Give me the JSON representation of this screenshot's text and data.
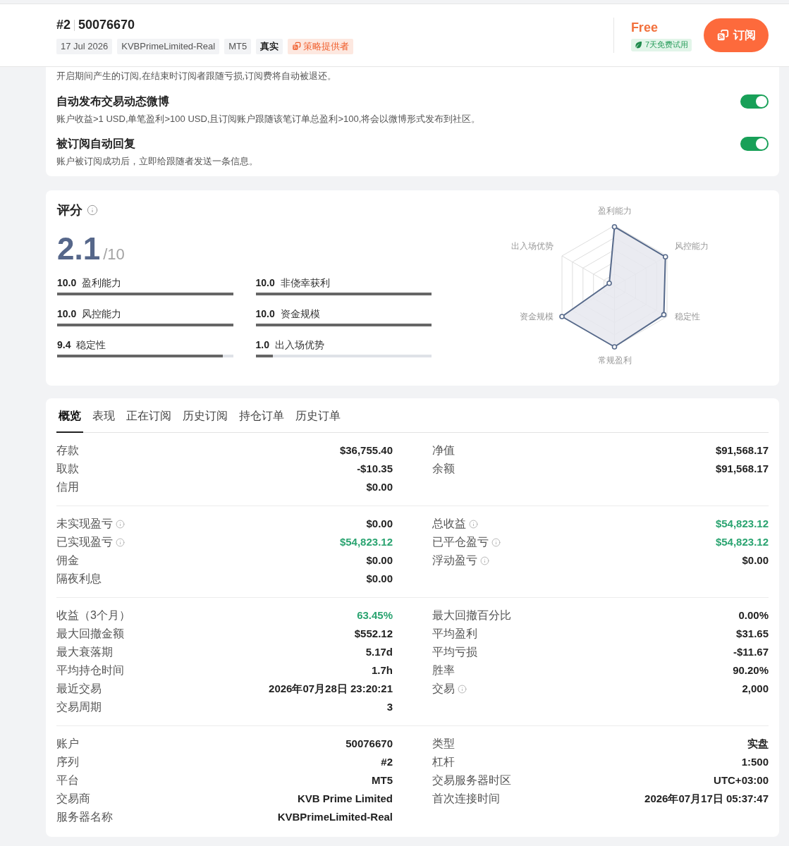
{
  "header": {
    "rank": "#2",
    "account": "50076670",
    "tags": [
      {
        "text": "17 Jul 2026",
        "kind": "plain"
      },
      {
        "text": "KVBPrimeLimited-Real",
        "kind": "plain"
      },
      {
        "text": "MT5",
        "kind": "plain"
      },
      {
        "text": "真实",
        "kind": "strong"
      },
      {
        "text": "策略提供者",
        "kind": "provider"
      }
    ],
    "price": "Free",
    "trial_badge": "7天免费试用",
    "subscribe_button": "订阅"
  },
  "settings": {
    "intro": "开启期间产生的订阅,在结束时订阅者跟随亏损,订阅费将自动被退还。",
    "items": [
      {
        "title": "自动发布交易动态微博",
        "description": "账户收益>1 USD,单笔盈利>100 USD,且订阅账户跟随该笔订单总盈利>100,将会以微博形式发布到社区。",
        "on": true
      },
      {
        "title": "被订阅自动回复",
        "description": "账户被订阅成功后，立即给跟随者发送一条信息。",
        "on": true
      }
    ]
  },
  "score": {
    "title": "评分",
    "value": "2.1",
    "max": "/10",
    "metrics": [
      {
        "score": "10.0",
        "label": "盈利能力",
        "level": 1
      },
      {
        "score": "10.0",
        "label": "非侥幸获利",
        "level": 1
      },
      {
        "score": "10.0",
        "label": "风控能力",
        "level": 1
      },
      {
        "score": "10.0",
        "label": "资金规模",
        "level": 1
      },
      {
        "score": "9.4",
        "label": "稳定性",
        "level": 0.94
      },
      {
        "score": "1.0",
        "label": "出入场优势",
        "level": 0.1
      }
    ],
    "radar_axes": [
      "盈利能力",
      "风控能力",
      "稳定性",
      "常规盈利",
      "资金规模",
      "出入场优势"
    ]
  },
  "tabs": [
    {
      "label": "概览",
      "selected": true
    },
    {
      "label": "表现",
      "selected": false
    },
    {
      "label": "正在订阅",
      "selected": false
    },
    {
      "label": "历史订阅",
      "selected": false
    },
    {
      "label": "持仓订单",
      "selected": false
    },
    {
      "label": "历史订单",
      "selected": false
    }
  ],
  "stats": [
    {
      "left": [
        {
          "label": "存款",
          "value": "$36,755.40",
          "info": false,
          "positive": false
        },
        {
          "label": "取款",
          "value": "-$10.35",
          "info": false,
          "positive": false
        },
        {
          "label": "信用",
          "value": "$0.00",
          "info": false,
          "positive": false
        }
      ],
      "right": [
        {
          "label": "净值",
          "value": "$91,568.17",
          "info": false,
          "positive": false
        },
        {
          "label": "余额",
          "value": "$91,568.17",
          "info": false,
          "positive": false
        }
      ]
    },
    {
      "left": [
        {
          "label": "未实现盈亏",
          "value": "$0.00",
          "info": true,
          "positive": false
        },
        {
          "label": "已实现盈亏",
          "value": "$54,823.12",
          "info": true,
          "positive": true
        },
        {
          "label": "佣金",
          "value": "$0.00",
          "info": false,
          "positive": false
        },
        {
          "label": "隔夜利息",
          "value": "$0.00",
          "info": false,
          "positive": false
        }
      ],
      "right": [
        {
          "label": "总收益",
          "value": "$54,823.12",
          "info": true,
          "positive": true
        },
        {
          "label": "已平仓盈亏",
          "value": "$54,823.12",
          "info": true,
          "positive": true
        },
        {
          "label": "浮动盈亏",
          "value": "$0.00",
          "info": true,
          "positive": false
        }
      ]
    },
    {
      "left": [
        {
          "label": "收益（3个月）",
          "value": "63.45%",
          "info": false,
          "positive": true
        },
        {
          "label": "最大回撤金额",
          "value": "$552.12",
          "info": false,
          "positive": false
        },
        {
          "label": "最大衰落期",
          "value": "5.17d",
          "info": false,
          "positive": false
        },
        {
          "label": "平均持仓时间",
          "value": "1.7h",
          "info": false,
          "positive": false
        },
        {
          "label": "最近交易",
          "value": "2026年07月28日 23:20:21",
          "info": false,
          "positive": false
        },
        {
          "label": "交易周期",
          "value": "3",
          "info": false,
          "positive": false
        }
      ],
      "right": [
        {
          "label": "最大回撤百分比",
          "value": "0.00%",
          "info": false,
          "positive": false
        },
        {
          "label": "平均盈利",
          "value": "$31.65",
          "info": false,
          "positive": false
        },
        {
          "label": "平均亏损",
          "value": "-$11.67",
          "info": false,
          "positive": false
        },
        {
          "label": "胜率",
          "value": "90.20%",
          "info": false,
          "positive": false
        },
        {
          "label": "交易",
          "value": "2,000",
          "info": true,
          "positive": false
        }
      ]
    },
    {
      "left": [
        {
          "label": "账户",
          "value": "50076670",
          "info": false,
          "positive": false
        },
        {
          "label": "序列",
          "value": "#2",
          "info": false,
          "positive": false
        },
        {
          "label": "平台",
          "value": "MT5",
          "info": false,
          "positive": false
        },
        {
          "label": "交易商",
          "value": "KVB Prime Limited",
          "info": false,
          "positive": false
        },
        {
          "label": "服务器名称",
          "value": "KVBPrimeLimited-Real",
          "info": false,
          "positive": false
        }
      ],
      "right": [
        {
          "label": "类型",
          "value": "实盘",
          "info": false,
          "positive": false
        },
        {
          "label": "杠杆",
          "value": "1:500",
          "info": false,
          "positive": false
        },
        {
          "label": "交易服务器时区",
          "value": "UTC+03:00",
          "info": false,
          "positive": false
        },
        {
          "label": "首次连接时间",
          "value": "2026年07月17日 05:37:47",
          "info": false,
          "positive": false
        }
      ]
    }
  ]
}
